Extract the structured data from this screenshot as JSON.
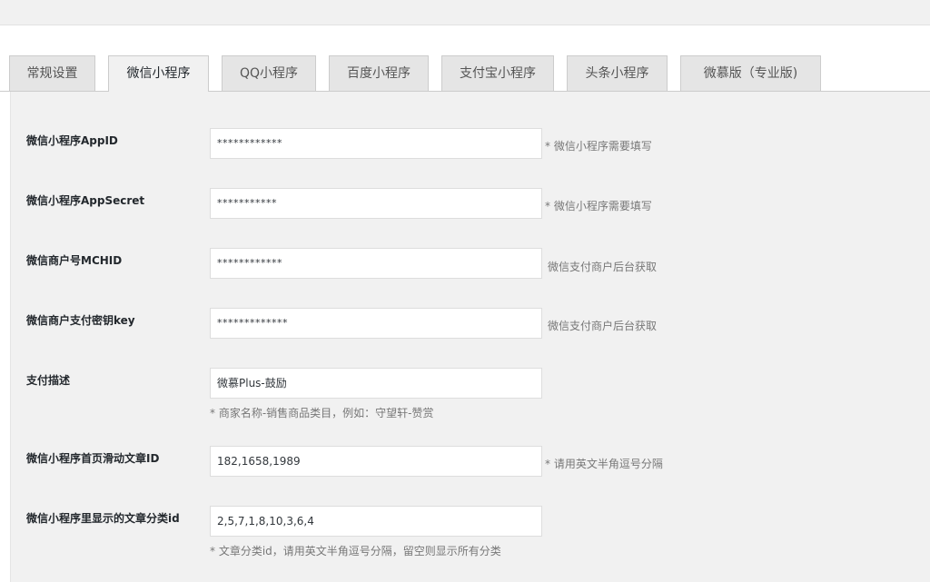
{
  "tabs": [
    {
      "label": "常规设置",
      "active": false
    },
    {
      "label": "微信小程序",
      "active": true
    },
    {
      "label": "QQ小程序",
      "active": false
    },
    {
      "label": "百度小程序",
      "active": false
    },
    {
      "label": "支付宝小程序",
      "active": false
    },
    {
      "label": "头条小程序",
      "active": false
    },
    {
      "label": "微慕版（专业版)",
      "active": false
    }
  ],
  "form": {
    "appid": {
      "label": "微信小程序AppID",
      "value": "************",
      "hint": "* 微信小程序需要填写"
    },
    "appsecret": {
      "label": "微信小程序AppSecret",
      "value": "***********",
      "hint": "* 微信小程序需要填写"
    },
    "mchid": {
      "label": "微信商户号MCHID",
      "value": "************",
      "hint": "微信支付商户后台获取"
    },
    "paykey": {
      "label": "微信商户支付密钥key",
      "value": "*************",
      "hint": "微信支付商户后台获取"
    },
    "paydesc": {
      "label": "支付描述",
      "value": "微慕Plus-鼓励",
      "hint": "* 商家名称-销售商品类目，例如：守望轩-赞赏"
    },
    "swiper": {
      "label": "微信小程序首页滑动文章ID",
      "value": "182,1658,1989",
      "hint": "* 请用英文半角逗号分隔"
    },
    "categories": {
      "label": "微信小程序里显示的文章分类id",
      "value": "2,5,7,1,8,10,3,6,4",
      "hint": "* 文章分类id，请用英文半角逗号分隔，留空则显示所有分类"
    }
  }
}
